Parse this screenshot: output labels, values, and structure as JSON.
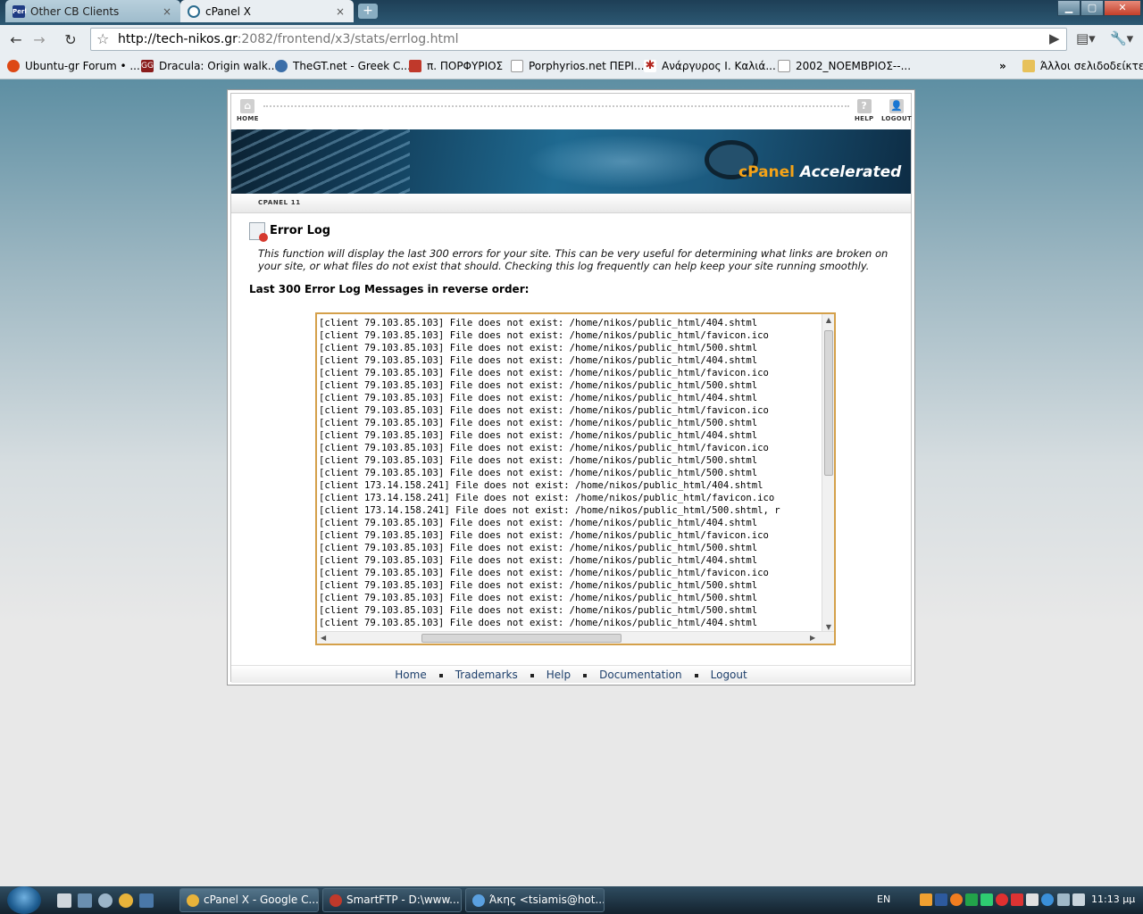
{
  "browser": {
    "tabs": [
      {
        "label": "Other CB Clients",
        "active": false
      },
      {
        "label": "cPanel X",
        "active": true
      }
    ],
    "new_tab": "+",
    "url_host": "http://tech-nikos.gr",
    "url_rest": ":2082/frontend/x3/stats/errlog.html",
    "bookmarks": [
      {
        "label": "Ubuntu-gr Forum • ...",
        "color": "#dd4814"
      },
      {
        "label": "Dracula: Origin walk...",
        "color": "#8a1c1c"
      },
      {
        "label": "TheGT.net - Greek C...",
        "color": "#3b6ea8"
      },
      {
        "label": "π. ΠΟΡΦΥΡΙΟΣ",
        "color": "#c0392b"
      },
      {
        "label": "Porphyrios.net ΠΕΡΙ...",
        "color": "#aaaaaa"
      },
      {
        "label": "Ανάργυρος Ι. Καλιά...",
        "color": "#b3261e"
      },
      {
        "label": "2002_ΝΟΕΜΒΡΙΟΣ--...",
        "color": "#aaaaaa"
      }
    ],
    "bookmarks_overflow": "»",
    "other_bookmarks": "Άλλοι σελιδοδείκτες"
  },
  "cpanel": {
    "nav": {
      "home": "HOME",
      "help": "HELP",
      "logout": "LOGOUT"
    },
    "brand_cpanel": "cPanel",
    "brand_accelerated": " Accelerated",
    "version": "CPANEL 11",
    "page_title": "Error Log",
    "description": "This function will display the last 300 errors for your site. This can be very useful for determining what links are broken on your site, or what files do not exist that should. Checking this log frequently can help keep your site running smoothly.",
    "log_heading": "Last 300 Error Log Messages in reverse order:",
    "log_lines": [
      "[client 79.103.85.103] File does not exist: /home/nikos/public_html/404.shtml",
      "[client 79.103.85.103] File does not exist: /home/nikos/public_html/favicon.ico",
      "[client 79.103.85.103] File does not exist: /home/nikos/public_html/500.shtml",
      "[client 79.103.85.103] File does not exist: /home/nikos/public_html/404.shtml",
      "[client 79.103.85.103] File does not exist: /home/nikos/public_html/favicon.ico",
      "[client 79.103.85.103] File does not exist: /home/nikos/public_html/500.shtml",
      "[client 79.103.85.103] File does not exist: /home/nikos/public_html/404.shtml",
      "[client 79.103.85.103] File does not exist: /home/nikos/public_html/favicon.ico",
      "[client 79.103.85.103] File does not exist: /home/nikos/public_html/500.shtml",
      "[client 79.103.85.103] File does not exist: /home/nikos/public_html/404.shtml",
      "[client 79.103.85.103] File does not exist: /home/nikos/public_html/favicon.ico",
      "[client 79.103.85.103] File does not exist: /home/nikos/public_html/500.shtml",
      "[client 79.103.85.103] File does not exist: /home/nikos/public_html/500.shtml",
      "[client 173.14.158.241] File does not exist: /home/nikos/public_html/404.shtml",
      "[client 173.14.158.241] File does not exist: /home/nikos/public_html/favicon.ico",
      "[client 173.14.158.241] File does not exist: /home/nikos/public_html/500.shtml, r",
      "[client 79.103.85.103] File does not exist: /home/nikos/public_html/404.shtml",
      "[client 79.103.85.103] File does not exist: /home/nikos/public_html/favicon.ico",
      "[client 79.103.85.103] File does not exist: /home/nikos/public_html/500.shtml",
      "[client 79.103.85.103] File does not exist: /home/nikos/public_html/404.shtml",
      "[client 79.103.85.103] File does not exist: /home/nikos/public_html/favicon.ico",
      "[client 79.103.85.103] File does not exist: /home/nikos/public_html/500.shtml",
      "[client 79.103.85.103] File does not exist: /home/nikos/public_html/500.shtml",
      "[client 79.103.85.103] File does not exist: /home/nikos/public_html/500.shtml",
      "[client 79.103.85.103] File does not exist: /home/nikos/public_html/404.shtml"
    ],
    "footer_links": [
      "Home",
      "Trademarks",
      "Help",
      "Documentation",
      "Logout"
    ]
  },
  "taskbar": {
    "tasks": [
      {
        "label": "cPanel X - Google C...",
        "active": true,
        "color": "#e8b33a"
      },
      {
        "label": "SmartFTP - D:\\www...",
        "active": false,
        "color": "#c0392b"
      },
      {
        "label": "Άκης <tsiamis@hot...",
        "active": false,
        "color": "#5aa0e0"
      }
    ],
    "language": "EN",
    "clock": "11:13 μμ"
  }
}
